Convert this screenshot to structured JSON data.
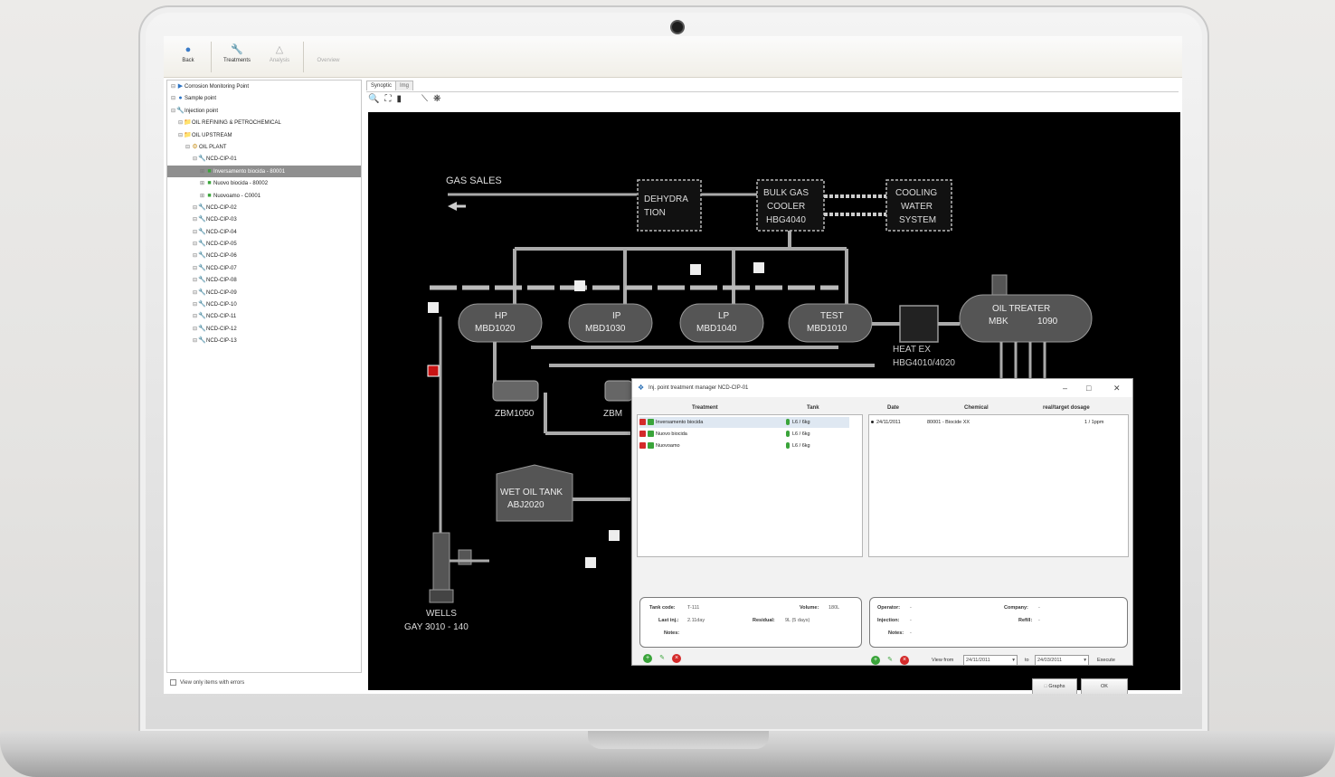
{
  "toolbar": {
    "buttons": [
      {
        "label": "Back",
        "icon": "back-icon",
        "enabled": true
      },
      {
        "label": "Treatments",
        "icon": "wrench-icon",
        "enabled": true
      },
      {
        "label": "Analysis",
        "icon": "flask-icon",
        "enabled": false
      },
      {
        "label": "Overview",
        "icon": "grid-icon",
        "enabled": false
      }
    ]
  },
  "tree": {
    "items": [
      {
        "label": "Corrosion Monitoring Point",
        "level": 0,
        "icon": "sensor-icon"
      },
      {
        "label": "Sample point",
        "level": 0,
        "icon": "sample-icon"
      },
      {
        "label": "Injection point",
        "level": 0,
        "icon": "wrench-icon"
      },
      {
        "label": "OIL REFINING & PETROCHEMICAL",
        "level": 1,
        "icon": "folder-icon"
      },
      {
        "label": "OIL UPSTREAM",
        "level": 1,
        "icon": "folder-icon"
      },
      {
        "label": "OIL PLANT",
        "level": 2,
        "icon": "plant-icon"
      },
      {
        "label": "NCD-CIP-01",
        "level": 3,
        "icon": "wrench-icon"
      },
      {
        "label": "Inversamento biocida - 80001",
        "level": 4,
        "icon": "treatment-icon",
        "selected": true
      },
      {
        "label": "Nuovo biocida - 80002",
        "level": 4,
        "icon": "treatment-icon"
      },
      {
        "label": "Nuovoamo - C0001",
        "level": 4,
        "icon": "treatment-icon"
      },
      {
        "label": "NCD-CIP-02",
        "level": 3,
        "icon": "wrench-icon"
      },
      {
        "label": "NCD-CIP-03",
        "level": 3,
        "icon": "wrench-icon"
      },
      {
        "label": "NCD-CIP-04",
        "level": 3,
        "icon": "wrench-icon"
      },
      {
        "label": "NCD-CIP-05",
        "level": 3,
        "icon": "wrench-icon"
      },
      {
        "label": "NCD-CIP-06",
        "level": 3,
        "icon": "wrench-icon"
      },
      {
        "label": "NCD-CIP-07",
        "level": 3,
        "icon": "wrench-icon"
      },
      {
        "label": "NCD-CIP-08",
        "level": 3,
        "icon": "wrench-icon"
      },
      {
        "label": "NCD-CIP-09",
        "level": 3,
        "icon": "wrench-icon"
      },
      {
        "label": "NCD-CIP-10",
        "level": 3,
        "icon": "wrench-icon"
      },
      {
        "label": "NCD-CIP-11",
        "level": 3,
        "icon": "wrench-icon"
      },
      {
        "label": "NCD-CIP-12",
        "level": 3,
        "icon": "wrench-icon"
      },
      {
        "label": "NCD-CIP-13",
        "level": 3,
        "icon": "wrench-icon"
      }
    ],
    "footer_checkbox": "View only items with errors"
  },
  "tabs": [
    "Synoptic",
    "Img"
  ],
  "synoptic": {
    "gas_sales": "GAS SALES",
    "dehydration": [
      "DEHYDRA",
      "TION"
    ],
    "bulk_gas": [
      "BULK GAS",
      "COOLER",
      "HBG4040"
    ],
    "cooling": [
      "COOLING",
      "WATER",
      "SYSTEM"
    ],
    "hp": [
      "HP",
      "MBD1020"
    ],
    "ip": [
      "IP",
      "MBD1030"
    ],
    "lp": [
      "LP",
      "MBD1040"
    ],
    "test": [
      "TEST",
      "MBD1010"
    ],
    "oil_treater": [
      "OIL TREATER",
      "MBK",
      "1090"
    ],
    "heat_ex": [
      "HEAT EX",
      "HBG4010/4020"
    ],
    "pump1": "ZBM1050",
    "pump2": "ZBM",
    "wet_tank": [
      "WET OIL TANK",
      "ABJ2020"
    ],
    "wells": [
      "WELLS",
      "GAY 3010 - 140"
    ]
  },
  "dialog": {
    "title": "Inj. point treatment manager NCD-CIP-01",
    "left_headers": {
      "treatment": "Treatment",
      "tank": "Tank"
    },
    "treatments": [
      {
        "name": "Inversamento biocida",
        "tank": "L6 / 6kg",
        "selected": true
      },
      {
        "name": "Nuovo biocida",
        "tank": "L6 / 6kg"
      },
      {
        "name": "Nuovoamo",
        "tank": "L6 / 6kg"
      }
    ],
    "right_headers": {
      "date": "Date",
      "chemical": "Chemical",
      "dosage": "real/target dosage"
    },
    "dosages": [
      {
        "date": "24/11/2011",
        "chemical": "80001 - Biocide XX",
        "dosage": "1 / 1ppm"
      }
    ],
    "tank_info": {
      "tank_code_label": "Tank code:",
      "tank_code": "T-111",
      "last_inj_label": "Last inj.:",
      "last_inj": "2.11day",
      "notes_label": "Notes:",
      "volume_label": "Volume:",
      "volume": "180L",
      "residual_label": "Residual:",
      "residual": "9L (5 days)"
    },
    "op_info": {
      "operator_label": "Operator:",
      "operator": "-",
      "injection_label": "Injection:",
      "injection": "-",
      "notes_label": "Notes:",
      "notes": "-",
      "company_label": "Company:",
      "company": "-",
      "refill_label": "Refill:",
      "refill": "-"
    },
    "filter": {
      "view_from_label": "View from",
      "from": "24/11/2011",
      "to_label": "to",
      "to": "24/03/2011",
      "execute_label": "Execute"
    },
    "buttons": {
      "graphs": "Graphs",
      "ok": "OK"
    }
  }
}
